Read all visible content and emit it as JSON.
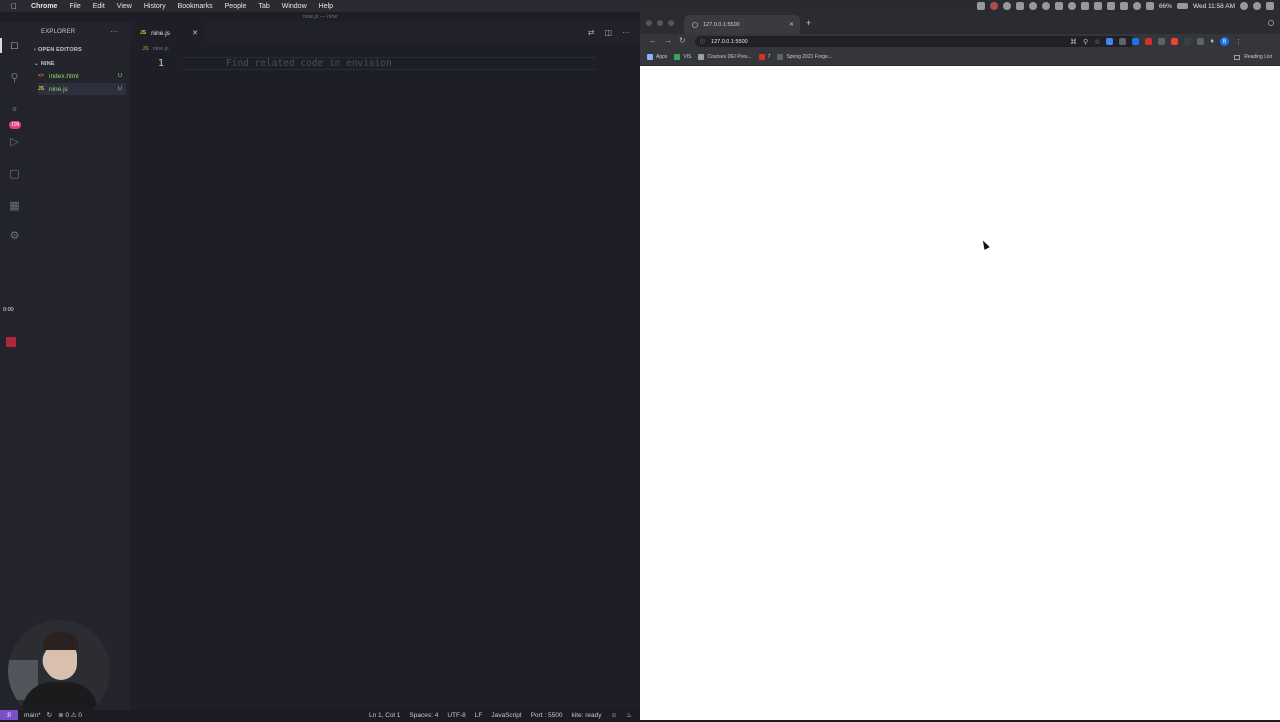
{
  "menubar": {
    "app": "Chrome",
    "items": [
      "File",
      "Edit",
      "View",
      "History",
      "Bookmarks",
      "People",
      "Tab",
      "Window",
      "Help"
    ],
    "battery": "66%",
    "clock": "Wed 11:58 AM"
  },
  "vscode": {
    "window_title": "nine.js — nine",
    "explorer": {
      "header": "EXPLORER",
      "open_editors": "OPEN EDITORS",
      "folder": "NINE",
      "files": [
        {
          "name": "index.html",
          "icon": "<>",
          "status": "U"
        },
        {
          "name": "nine.js",
          "icon": "JS",
          "status": "U"
        }
      ]
    },
    "badge": "109",
    "timer": "0:00",
    "tab": {
      "icon": "JS",
      "label": "nine.js"
    },
    "breadcrumb": {
      "icon": "JS",
      "label": "nine.js"
    },
    "editor": {
      "line_number": "1",
      "ghost_text": "Find related code in envision"
    },
    "statusbar": {
      "branch": "main*",
      "problems": "⊗ 0 ⚠ 0",
      "position": "Ln 1, Col 1",
      "spaces": "Spaces: 4",
      "encoding": "UTF-8",
      "eol": "LF",
      "language": "JavaScript",
      "port": "Port : 5500",
      "kite": "kite: ready"
    }
  },
  "chrome": {
    "tab_title": "127.0.0.1:5500",
    "url": "127.0.0.1:5500",
    "profile_initial": "B",
    "bookmarks": [
      {
        "label": "Apps",
        "color": "#8ab4f8"
      },
      {
        "label": "VIS",
        "color": "#34a853"
      },
      {
        "label": "Courses DEI Pres...",
        "color": "#9aa0a6"
      },
      {
        "label": "7",
        "color": "#d93025"
      },
      {
        "label": "Spring 2021 Forge...",
        "color": "#5f6368"
      }
    ],
    "reading_list": "Reading List"
  }
}
